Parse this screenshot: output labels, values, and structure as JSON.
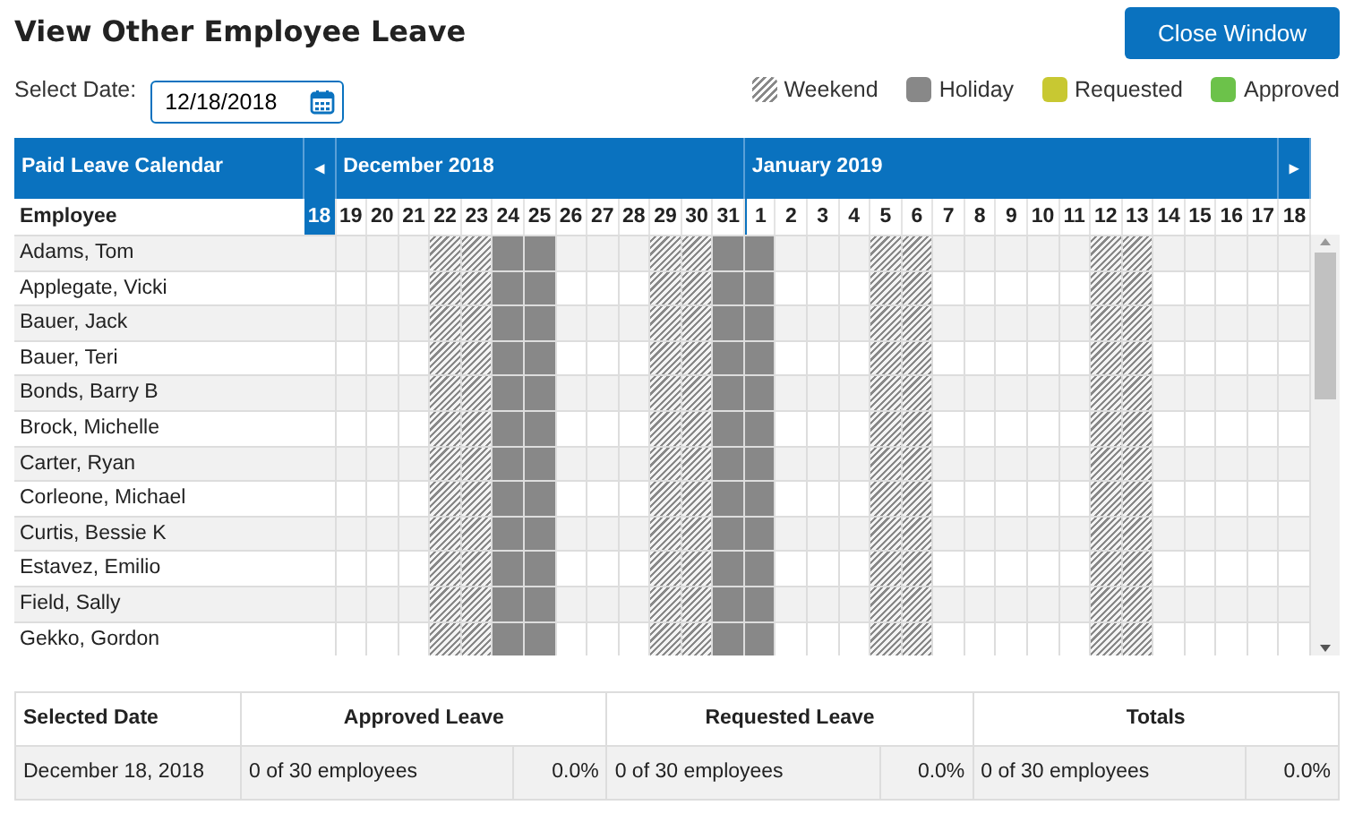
{
  "title": "View Other Employee Leave",
  "close_button": "Close Window",
  "date_picker": {
    "label": "Select Date:",
    "value": "12/18/2018"
  },
  "legend": [
    {
      "label": "Weekend",
      "kind": "hatch",
      "color": "#888888"
    },
    {
      "label": "Holiday",
      "kind": "solid",
      "color": "#888888"
    },
    {
      "label": "Requested",
      "kind": "solid",
      "color": "#c8c832"
    },
    {
      "label": "Approved",
      "kind": "solid",
      "color": "#6cc24a"
    }
  ],
  "calendar": {
    "title": "Paid Leave Calendar",
    "prev": "◂",
    "next": "▸",
    "employee_header": "Employee",
    "months": [
      {
        "label": "December 2018"
      },
      {
        "label": "January 2019"
      }
    ],
    "days": [
      {
        "label": "18",
        "kind": "weekday",
        "selected": true
      },
      {
        "label": "19",
        "kind": "weekday",
        "selected": false
      },
      {
        "label": "20",
        "kind": "weekday",
        "selected": false
      },
      {
        "label": "21",
        "kind": "weekday",
        "selected": false
      },
      {
        "label": "22",
        "kind": "weekend",
        "selected": false
      },
      {
        "label": "23",
        "kind": "weekend",
        "selected": false
      },
      {
        "label": "24",
        "kind": "holiday",
        "selected": false
      },
      {
        "label": "25",
        "kind": "holiday",
        "selected": false
      },
      {
        "label": "26",
        "kind": "weekday",
        "selected": false
      },
      {
        "label": "27",
        "kind": "weekday",
        "selected": false
      },
      {
        "label": "28",
        "kind": "weekday",
        "selected": false
      },
      {
        "label": "29",
        "kind": "weekend",
        "selected": false
      },
      {
        "label": "30",
        "kind": "weekend",
        "selected": false
      },
      {
        "label": "31",
        "kind": "holiday",
        "selected": false
      },
      {
        "label": "1",
        "kind": "holiday",
        "selected": false,
        "month_start": true
      },
      {
        "label": "2",
        "kind": "weekday",
        "selected": false
      },
      {
        "label": "3",
        "kind": "weekday",
        "selected": false
      },
      {
        "label": "4",
        "kind": "weekday",
        "selected": false
      },
      {
        "label": "5",
        "kind": "weekend",
        "selected": false
      },
      {
        "label": "6",
        "kind": "weekend",
        "selected": false
      },
      {
        "label": "7",
        "kind": "weekday",
        "selected": false
      },
      {
        "label": "8",
        "kind": "weekday",
        "selected": false
      },
      {
        "label": "9",
        "kind": "weekday",
        "selected": false
      },
      {
        "label": "10",
        "kind": "weekday",
        "selected": false
      },
      {
        "label": "11",
        "kind": "weekday",
        "selected": false
      },
      {
        "label": "12",
        "kind": "weekend",
        "selected": false
      },
      {
        "label": "13",
        "kind": "weekend",
        "selected": false
      },
      {
        "label": "14",
        "kind": "weekday",
        "selected": false
      },
      {
        "label": "15",
        "kind": "weekday",
        "selected": false
      },
      {
        "label": "16",
        "kind": "weekday",
        "selected": false
      },
      {
        "label": "17",
        "kind": "weekday",
        "selected": false
      },
      {
        "label": "18",
        "kind": "weekday",
        "selected": false
      }
    ],
    "employees": [
      "Adams, Tom",
      "Applegate, Vicki",
      "Bauer, Jack",
      "Bauer, Teri",
      "Bonds, Barry B",
      "Brock, Michelle",
      "Carter, Ryan",
      "Corleone, Michael",
      "Curtis, Bessie K",
      "Estavez, Emilio",
      "Field, Sally",
      "Gekko, Gordon"
    ]
  },
  "summary": {
    "columns": [
      "Selected Date",
      "Approved Leave",
      "Requested Leave",
      "Totals"
    ],
    "date": "December 18, 2018",
    "values": [
      {
        "count": "0 of 30 employees",
        "percent": "0.0%"
      },
      {
        "count": "0 of 30 employees",
        "percent": "0.0%"
      },
      {
        "count": "0 of 30 employees",
        "percent": "0.0%"
      }
    ]
  }
}
